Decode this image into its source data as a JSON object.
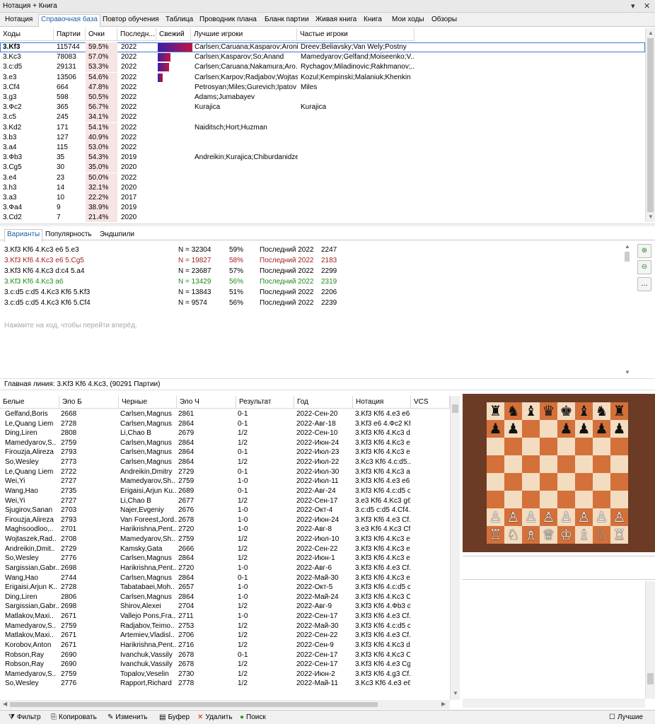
{
  "title": "Нотация + Книга",
  "tabs": [
    "Нотация",
    "Справочная база",
    "Повтор обучения",
    "Таблица",
    "Проводник плана",
    "Бланк партии",
    "Живая книга",
    "Книга",
    "Мои ходы",
    "Обзоры"
  ],
  "moves_headers": [
    "Ходы",
    "Партии",
    "Очки",
    "Последн...",
    "Свежий",
    "Лучшие игроки",
    "Частые игроки"
  ],
  "moves": [
    [
      "3.Kf3",
      "115744",
      "59.5%",
      "2022",
      "Carlsen;Caruana;Kasparov;Aroni...",
      "Dreev;Beliavsky;Van Wely;Postny"
    ],
    [
      "3.Kc3",
      "78083",
      "57.0%",
      "2022",
      "Carlsen;Kasparov;So;Anand",
      "Mamedyarov;Gelfand;Moiseenko;V.."
    ],
    [
      "3.c:d5",
      "29131",
      "53.3%",
      "2022",
      "Carlsen;Caruana;Nakamura;Aro..",
      "Rychagov;Miladinovic;Rakhmanov;.."
    ],
    [
      "3.e3",
      "13506",
      "54.6%",
      "2022",
      "Carlsen;Karpov;Radjabov;Wojtas..",
      "Kozul;Kempinski;Malaniuk;Khenkin"
    ],
    [
      "3.Cf4",
      "664",
      "47.8%",
      "2022",
      "Petrosyan;Miles;Gurevich;Ipatov",
      "Miles"
    ],
    [
      "3.g3",
      "598",
      "50.5%",
      "2022",
      "Adams;Jumabayev",
      ""
    ],
    [
      "3.Фc2",
      "365",
      "56.7%",
      "2022",
      "Kurajica",
      "Kurajica"
    ],
    [
      "3.c5",
      "245",
      "34.1%",
      "2022",
      "",
      ""
    ],
    [
      "3.Kd2",
      "171",
      "54.1%",
      "2022",
      "Naiditsch;Hort;Huzman",
      ""
    ],
    [
      "3.b3",
      "127",
      "40.9%",
      "2022",
      "",
      ""
    ],
    [
      "3.a4",
      "115",
      "53.0%",
      "2022",
      "",
      ""
    ],
    [
      "3.Фb3",
      "35",
      "54.3%",
      "2019",
      "Andreikin;Kurajica;Chiburdanidze",
      ""
    ],
    [
      "3.Cg5",
      "30",
      "35.0%",
      "2020",
      "",
      ""
    ],
    [
      "3.e4",
      "23",
      "50.0%",
      "2022",
      "",
      ""
    ],
    [
      "3.h3",
      "14",
      "32.1%",
      "2020",
      "",
      ""
    ],
    [
      "3.a3",
      "10",
      "22.2%",
      "2017",
      "",
      ""
    ],
    [
      "3.Фa4",
      "9",
      "38.9%",
      "2019",
      "",
      ""
    ],
    [
      "3.Cd2",
      "7",
      "21.4%",
      "2020",
      "",
      ""
    ]
  ],
  "variant_tabs": [
    "Варианты",
    "Популярность",
    "Эндшпили"
  ],
  "variants": [
    {
      "line": "3.Kf3 Kf6 4.Kc3 e6 5.e3",
      "n": "N = 32304",
      "pct": "59%",
      "last": "Последний 2022",
      "elo": "2247",
      "color": "#000000"
    },
    {
      "line": "3.Kf3 Kf6 4.Kc3 e6 5.Cg5",
      "n": "N = 19827",
      "pct": "58%",
      "last": "Последний 2022",
      "elo": "2183",
      "color": "#a32020"
    },
    {
      "line": "3.Kf3 Kf6 4.Kc3 d:c4 5.a4",
      "n": "N = 23687",
      "pct": "57%",
      "last": "Последний 2022",
      "elo": "2299",
      "color": "#000000"
    },
    {
      "line": "3.Kf3 Kf6 4.Kc3 a6",
      "n": "N = 13429",
      "pct": "56%",
      "last": "Последний 2022",
      "elo": "2319",
      "color": "#1e8a1e"
    },
    {
      "line": "3.c:d5 c:d5 4.Kc3 Kf6 5.Kf3",
      "n": "N = 13843",
      "pct": "51%",
      "last": "Последний 2022",
      "elo": "2206",
      "color": "#000000"
    },
    {
      "line": "3.c:d5 c:d5 4.Kc3 Kf6 5.Cf4",
      "n": "N = 9574",
      "pct": "56%",
      "last": "Последний 2022",
      "elo": "2239",
      "color": "#000000"
    }
  ],
  "hint": "Нажмите на ход, чтобы перейти вперёд.",
  "mainline": "Главная линия: 3.Kf3 Kf6 4.Kc3,  (90291 Партии)",
  "games_headers": [
    "Белые",
    "Эло Б",
    "Черные",
    "Эло Ч",
    "Результат",
    "Год",
    "Нотация",
    "VCS"
  ],
  "games": [
    [
      "Gelfand,Boris",
      "2668",
      "Carlsen,Magnus",
      "2861",
      "0-1",
      "2022-Сен-20",
      "3.Kf3 Kf6 4.e3 e6.."
    ],
    [
      "Le,Quang Liem",
      "2728",
      "Carlsen,Magnus",
      "2864",
      "0-1",
      "2022-Авг-18",
      "3.Kf3 e6 4.Фc2 Kf.."
    ],
    [
      "Ding,Liren",
      "2808",
      "Li,Chao B",
      "2679",
      "1/2",
      "2022-Сен-10",
      "3.Kf3 Kf6 4.Kc3 d:.."
    ],
    [
      "Mamedyarov,S..",
      "2759",
      "Carlsen,Magnus",
      "2864",
      "1/2",
      "2022-Июн-24",
      "3.Kf3 Kf6 4.Kc3 e.."
    ],
    [
      "Firouzja,Alireza",
      "2793",
      "Carlsen,Magnus",
      "2864",
      "0-1",
      "2022-Июл-23",
      "3.Kf3 Kf6 4.Kc3 e.."
    ],
    [
      "So,Wesley",
      "2773",
      "Carlsen,Magnus",
      "2864",
      "1/2",
      "2022-Июл-22",
      "3.Kc3 Kf6 4.c:d5.."
    ],
    [
      "Le,Quang Liem",
      "2722",
      "Andreikin,Dmitry",
      "2729",
      "0-1",
      "2022-Июл-30",
      "3.Kf3 Kf6 4.Kc3 a.."
    ],
    [
      "Wei,Yi",
      "2727",
      "Mamedyarov,Sh..",
      "2759",
      "1-0",
      "2022-Июл-11",
      "3.Kf3 Kf6 4.e3 e6.."
    ],
    [
      "Wang,Hao",
      "2735",
      "Erigaisi,Arjun Ku..",
      "2689",
      "0-1",
      "2022-Авг-24",
      "3.Kf3 Kf6 4.c:d5 c.."
    ],
    [
      "Wei,Yi",
      "2727",
      "Li,Chao B",
      "2677",
      "1/2",
      "2022-Сен-17",
      "3.e3 Kf6 4.Kc3 g6.."
    ],
    [
      "Sjugirov,Sanan",
      "2703",
      "Najer,Evgeniy",
      "2676",
      "1-0",
      "2022-Окт-4",
      "3.c:d5 c:d5 4.Cf4.."
    ],
    [
      "Firouzja,Alireza",
      "2793",
      "Van Foreest,Jord..",
      "2678",
      "1-0",
      "2022-Июн-24",
      "3.Kf3 Kf6 4.e3 Cf.."
    ],
    [
      "Maghsoodloo,..",
      "2701",
      "Harikrishna,Pent..",
      "2720",
      "1-0",
      "2022-Авг-8",
      "3.e3 Kf6 4.Kc3 Cf.."
    ],
    [
      "Wojtaszek,Rad..",
      "2708",
      "Mamedyarov,Sh..",
      "2759",
      "1/2",
      "2022-Июл-10",
      "3.Kf3 Kf6 4.Kc3 e.."
    ],
    [
      "Andreikin,Dmit..",
      "2729",
      "Kamsky,Gata",
      "2666",
      "1/2",
      "2022-Сен-22",
      "3.Kf3 Kf6 4.Kc3 e.."
    ],
    [
      "So,Wesley",
      "2776",
      "Carlsen,Magnus",
      "2864",
      "1/2",
      "2022-Июн-1",
      "3.Kf3 Kf6 4.Kc3 e.."
    ],
    [
      "Sargissian,Gabr..",
      "2698",
      "Harikrishna,Pent..",
      "2720",
      "1-0",
      "2022-Авг-6",
      "3.Kf3 Kf6 4.e3 Cf.."
    ],
    [
      "Wang,Hao",
      "2744",
      "Carlsen,Magnus",
      "2864",
      "0-1",
      "2022-Май-30",
      "3.Kf3 Kf6 4.Kc3 e.."
    ],
    [
      "Erigaisi,Arjun K..",
      "2728",
      "Tabatabaei,Moh..",
      "2657",
      "1-0",
      "2022-Окт-5",
      "3.Kf3 Kf6 4.c:d5 c.."
    ],
    [
      "Ding,Liren",
      "2806",
      "Carlsen,Magnus",
      "2864",
      "1-0",
      "2022-Май-24",
      "3.Kf3 Kf6 4.Kc3 Cg.."
    ],
    [
      "Sargissian,Gabr..",
      "2698",
      "Shirov,Alexei",
      "2704",
      "1/2",
      "2022-Авг-9",
      "3.Kf3 Kf6 4.Фb3 d.."
    ],
    [
      "Matlakov,Maxi..",
      "2671",
      "Vallejo Pons,Fra..",
      "2711",
      "1-0",
      "2022-Сен-17",
      "3.Kf3 Kf6 4.e3 Cf.."
    ],
    [
      "Mamedyarov,S..",
      "2759",
      "Radjabov,Teimo..",
      "2753",
      "1/2",
      "2022-Май-30",
      "3.Kf3 Kf6 4.c:d5 c.."
    ],
    [
      "Matlakov,Maxi..",
      "2671",
      "Artemiev,Vladisl..",
      "2706",
      "1/2",
      "2022-Сен-22",
      "3.Kf3 Kf6 4.e3 Cf.."
    ],
    [
      "Korobov,Anton",
      "2671",
      "Harikrishna,Pent..",
      "2716",
      "1/2",
      "2022-Сен-9",
      "3.Kf3 Kf6 4.Kc3 d:.."
    ],
    [
      "Robson,Ray",
      "2690",
      "Ivanchuk,Vassily",
      "2678",
      "0-1",
      "2022-Сен-17",
      "3.Kf3 Kf6 4.Kc3 Cg.."
    ],
    [
      "Robson,Ray",
      "2690",
      "Ivanchuk,Vassily",
      "2678",
      "1/2",
      "2022-Сен-17",
      "3.Kf3 Kf6 4.e3 Cg.."
    ],
    [
      "Mamedyarov,S..",
      "2759",
      "Topalov,Veselin",
      "2730",
      "1/2",
      "2022-Июн-2",
      "3.Kf3 Kf6 4.g3 Cf.."
    ],
    [
      "So,Wesley",
      "2776",
      "Rapport,Richard",
      "2778",
      "1/2",
      "2022-Май-11",
      "3.Kc3 Kf6 4.e3 e6.."
    ]
  ],
  "toolbar": {
    "filter": "Фильтр",
    "copy": "Копировать",
    "edit": "Изменить",
    "buffer": "Буфер",
    "delete": "Удалить",
    "search": "Поиск",
    "best": "Лучшие"
  },
  "icons": [
    "close-icon",
    "zoom-in-icon",
    "zoom-out-icon",
    "more-icon",
    "filter-icon",
    "copy-icon",
    "edit-icon",
    "buffer-icon",
    "delete-icon",
    "search-icon"
  ],
  "colors": {
    "accent": "#1a5fa8",
    "score_bg": "#f7e4e4",
    "fresh_bar": "#3a1fa8",
    "board_dark": "#d4703a",
    "board_light": "#f3dcc0",
    "frame": "#6b3b25"
  },
  "board": [
    [
      "♜",
      "♞",
      "♝",
      "♛",
      "♚",
      "♝",
      "♞",
      "♜"
    ],
    [
      "♟",
      "♟",
      "",
      "",
      "♟",
      "♟",
      "♟",
      "♟"
    ],
    [
      "",
      "",
      "",
      "",
      "",
      "",
      "",
      ""
    ],
    [
      "",
      "",
      "",
      "",
      "",
      "",
      "",
      ""
    ],
    [
      "",
      "",
      "",
      "",
      "",
      "",
      "",
      ""
    ],
    [
      "",
      "",
      "",
      "",
      "",
      "",
      "",
      ""
    ],
    [
      "♙",
      "♙",
      "♙",
      "♙",
      "♙",
      "♙",
      "♙",
      "♙"
    ],
    [
      "♖",
      "♘",
      "♗",
      "♕",
      "♔",
      "♗",
      "♘",
      "♖"
    ]
  ],
  "fresh": [
    1.0,
    0.35,
    0.3,
    0.1
  ]
}
